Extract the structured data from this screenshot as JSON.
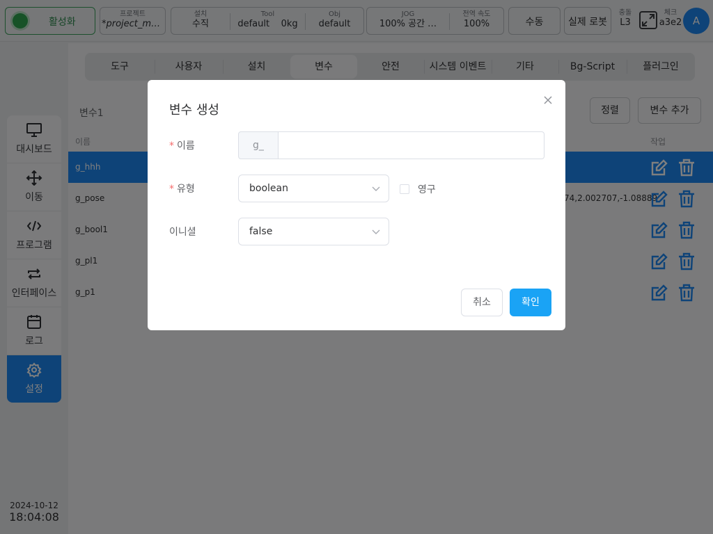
{
  "topbar": {
    "activate_label": "활성화",
    "project": {
      "caption": "프로젝트",
      "value": "*project_mo…"
    },
    "install": {
      "seg1": {
        "caption": "설치",
        "value": "수직"
      },
      "seg2": {
        "caption": "Tool",
        "value": "default",
        "value2": "0kg"
      },
      "seg3": {
        "caption": "Obj",
        "value": "default"
      }
    },
    "jog": {
      "seg1": {
        "caption": "JOG",
        "value": "100%  공간 …"
      },
      "seg2": {
        "caption": "전역 속도",
        "value": "100%"
      }
    },
    "manual_label": "수동",
    "real_robot_label": "실제 로봇",
    "collision": {
      "caption": "충돌",
      "value": "L3"
    },
    "check": {
      "caption": "체크",
      "value": "a3e2"
    },
    "avatar_letter": "A"
  },
  "sidebar": {
    "items": [
      {
        "label": "대시보드",
        "icon": "monitor-icon"
      },
      {
        "label": "이동",
        "icon": "move-arrows-icon"
      },
      {
        "label": "프로그램",
        "icon": "code-icon"
      },
      {
        "label": "인터페이스",
        "icon": "swap-arrows-icon"
      },
      {
        "label": "로그",
        "icon": "calendar-icon"
      },
      {
        "label": "설정",
        "icon": "gear-icon",
        "active": true
      }
    ],
    "date": "2024-10-12",
    "time": "18:04:08"
  },
  "tabs": [
    "도구",
    "사용자",
    "설치",
    "변수",
    "안전",
    "시스템 이벤트",
    "기타",
    "Bg-Script",
    "플러그인"
  ],
  "active_tab": "변수",
  "variables": {
    "header": "변수1",
    "sort_label": "정렬",
    "add_label": "변수 추가",
    "col_name": "이름",
    "col_action": "작업",
    "rows": [
      {
        "name": "g_hhh",
        "value": "",
        "selected": true
      },
      {
        "name": "g_pose",
        "value": "74,2.002707,-1.08889"
      },
      {
        "name": "g_bool1",
        "value": ""
      },
      {
        "name": "g_pl1",
        "value": ""
      },
      {
        "name": "g_p1",
        "value": ""
      }
    ]
  },
  "dialog": {
    "title": "변수 생성",
    "name_label": "이름",
    "name_prefix": "g_",
    "name_value": "",
    "type_label": "유형",
    "type_value": "boolean",
    "persistent_label": "영구",
    "initial_label": "이니셜",
    "initial_value": "false",
    "cancel_label": "취소",
    "ok_label": "확인",
    "required_mark": "*"
  },
  "colors": {
    "accent": "#1d86f0",
    "primary_button": "#1aa3f5",
    "active_green": "#2ea44f",
    "required": "#f56c6c"
  }
}
